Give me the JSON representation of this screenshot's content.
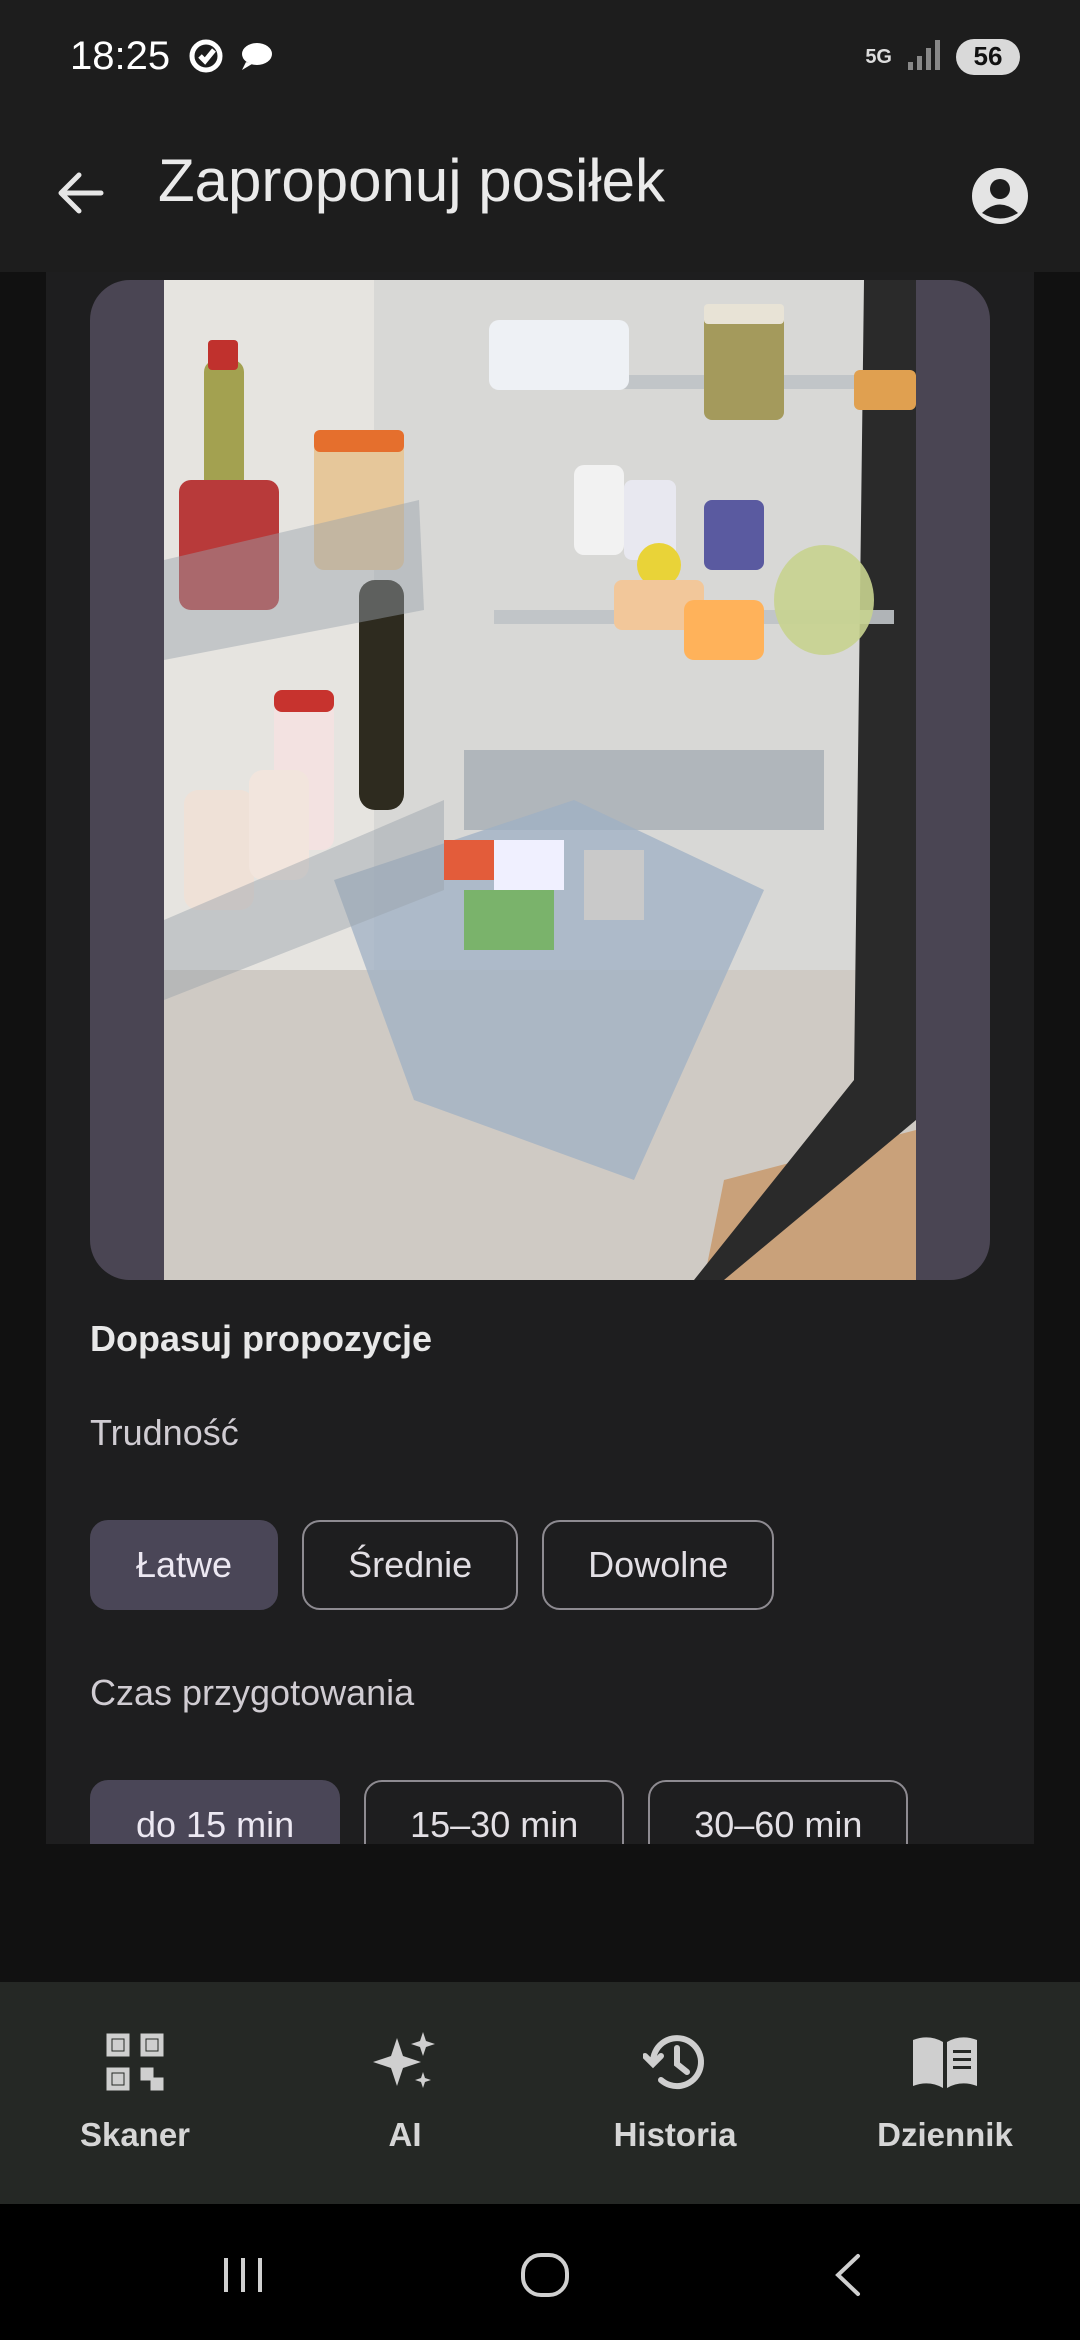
{
  "status": {
    "time": "18:25",
    "battery": "56",
    "network": "5G"
  },
  "appbar": {
    "title": "Zaproponuj posiłek"
  },
  "main": {
    "photo_alt": "fridge photo",
    "section_title": "Dopasuj propozycje",
    "difficulty_label": "Trudność",
    "difficulty_options": [
      "Łatwe",
      "Średnie",
      "Dowolne"
    ],
    "difficulty_selected": "Łatwe",
    "time_label": "Czas przygotowania",
    "time_options": [
      "do 15 min",
      "15–30 min",
      "30–60 min"
    ],
    "time_selected": "do 15 min"
  },
  "bottom_nav": {
    "items": [
      {
        "label": "Skaner",
        "icon": "qr-scanner-icon"
      },
      {
        "label": "AI",
        "icon": "sparkle-icon"
      },
      {
        "label": "Historia",
        "icon": "history-icon"
      },
      {
        "label": "Dziennik",
        "icon": "book-icon"
      }
    ]
  },
  "colors": {
    "accent_chip": "#4a4657",
    "background": "#111111",
    "bar": "#1d1d1d",
    "nav": "#252825"
  }
}
